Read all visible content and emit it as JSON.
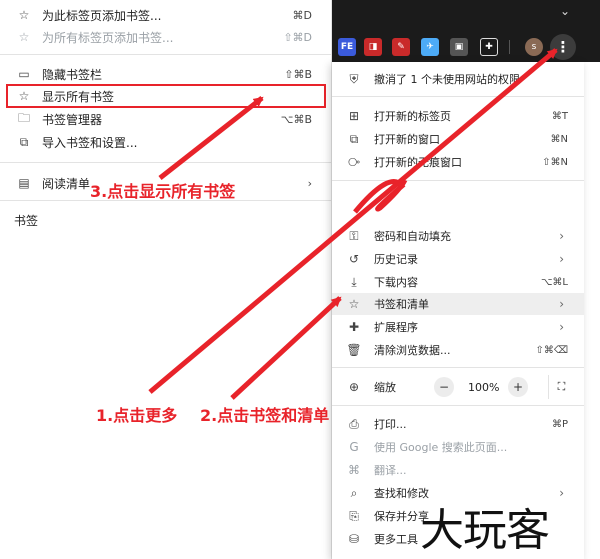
{
  "bookmark_menu": {
    "items": [
      {
        "icon": "star-icon",
        "label": "为此标签页添加书签...",
        "shortcut": "⌘D",
        "dim": false
      },
      {
        "icon": "star-icon",
        "label": "为所有标签页添加书签...",
        "shortcut": "⇧⌘D",
        "dim": true
      },
      {
        "icon": "bookmarks-bar-icon",
        "label": "隐藏书签栏",
        "shortcut": "⇧⌘B",
        "dim": false
      },
      {
        "icon": "star-icon",
        "label": "显示所有书签",
        "shortcut": "",
        "dim": false
      },
      {
        "icon": "folder-icon",
        "label": "书签管理器",
        "shortcut": "⌥⌘B",
        "dim": false
      },
      {
        "icon": "import-icon",
        "label": "导入书签和设置...",
        "shortcut": "",
        "dim": false
      }
    ],
    "reading_list": {
      "label": "阅读清单"
    },
    "heading": "书签"
  },
  "toolbar": {
    "extensions": [
      {
        "name": "fe-extension-icon",
        "text": "FE",
        "color": "#3b5bdb"
      },
      {
        "name": "book-extension-icon",
        "text": "◨",
        "color": "#c92a2a"
      },
      {
        "name": "pen-extension-icon",
        "text": "✎",
        "color": "#c92a2a"
      },
      {
        "name": "bird-extension-icon",
        "text": "✈",
        "color": "#4dabf7"
      },
      {
        "name": "screen-extension-icon",
        "text": "▣",
        "color": "#555555"
      },
      {
        "name": "puzzle-extension-icon",
        "text": "✚",
        "color": "#1b1b1b"
      }
    ],
    "avatar": "s"
  },
  "main_menu": {
    "notice": "撤消了 1 个未使用网站的权限",
    "new_tab": {
      "label": "打开新的标签页",
      "shortcut": "⌘T"
    },
    "new_window": {
      "label": "打开新的窗口",
      "shortcut": "⌘N"
    },
    "incognito": {
      "label": "打开新的无痕窗口",
      "shortcut": "⇧⌘N"
    },
    "passwords": {
      "label": "密码和自动填充"
    },
    "history": {
      "label": "历史记录"
    },
    "downloads": {
      "label": "下载内容",
      "shortcut": "⌥⌘L"
    },
    "bookmarks": {
      "label": "书签和清单"
    },
    "extensions": {
      "label": "扩展程序"
    },
    "clear_data": {
      "label": "清除浏览数据...",
      "shortcut": "⇧⌘⌫"
    },
    "zoom": {
      "label": "缩放",
      "minus": "−",
      "value": "100%",
      "plus": "+",
      "fullscreen": "⛶"
    },
    "print": {
      "label": "打印...",
      "shortcut": "⌘P"
    },
    "google_search": {
      "label": "使用 Google 搜索此页面..."
    },
    "translate": {
      "label": "翻译..."
    },
    "find_edit": {
      "label": "查找和修改"
    },
    "save_share": {
      "label": "保存并分享"
    },
    "more_tools": {
      "label": "更多工具"
    }
  },
  "annotations": {
    "step1": "1.点击更多",
    "step2": "2.点击书签和清单",
    "step3": "3.点击显示所有书签",
    "accent": "#e8232a"
  },
  "watermark": "大玩客"
}
